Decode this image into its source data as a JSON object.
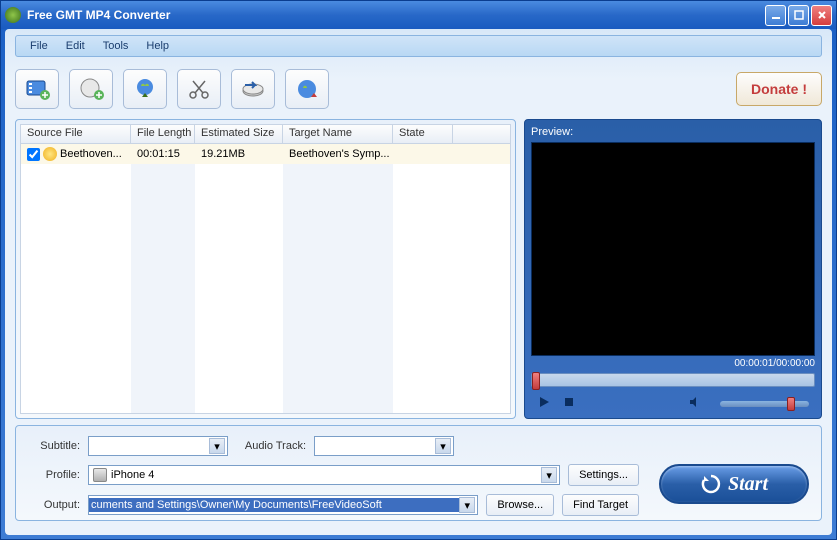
{
  "title": "Free GMT MP4 Converter",
  "menu": {
    "file": "File",
    "edit": "Edit",
    "tools": "Tools",
    "help": "Help"
  },
  "toolbar": {
    "donate": "Donate !"
  },
  "table": {
    "headers": {
      "source": "Source File",
      "length": "File Length",
      "size": "Estimated Size",
      "target": "Target Name",
      "state": "State"
    },
    "rows": [
      {
        "checked": true,
        "source": "Beethoven...",
        "length": "00:01:15",
        "size": "19.21MB",
        "target": "Beethoven's Symp...",
        "state": ""
      }
    ]
  },
  "preview": {
    "label": "Preview:",
    "time": "00:00:01/00:00:00"
  },
  "form": {
    "subtitle_label": "Subtitle:",
    "audio_label": "Audio Track:",
    "profile_label": "Profile:",
    "profile_value": "iPhone 4",
    "output_label": "Output:",
    "output_value": "cuments and Settings\\Owner\\My Documents\\FreeVideoSoft",
    "settings_btn": "Settings...",
    "browse_btn": "Browse...",
    "find_target_btn": "Find Target"
  },
  "start": "Start"
}
